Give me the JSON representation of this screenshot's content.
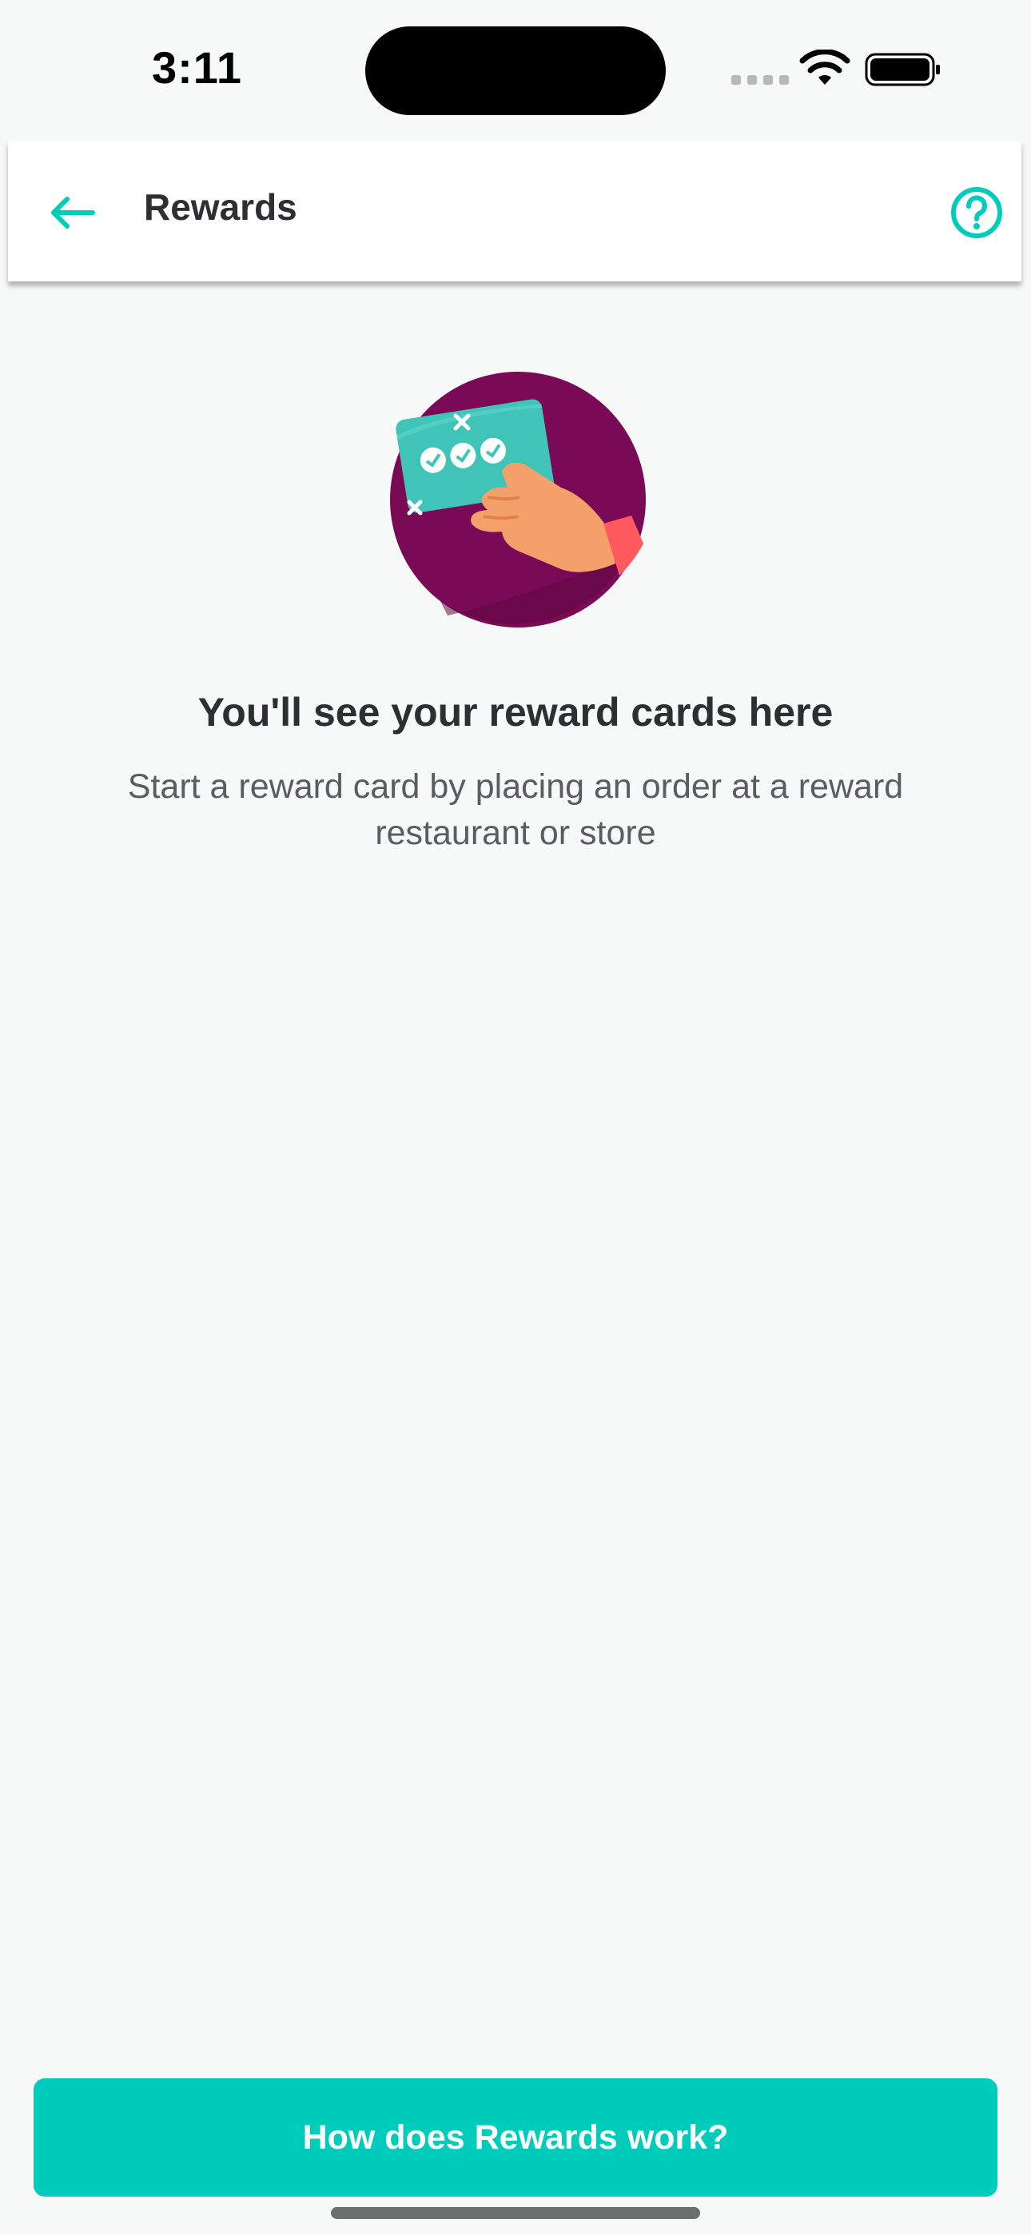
{
  "status_bar": {
    "time": "3:11"
  },
  "header": {
    "title": "Rewards",
    "back_icon": "arrow-left-icon",
    "help_icon": "question-circle-icon"
  },
  "empty_state": {
    "illustration": "hand-holding-reward-card-illustration",
    "title": "You'll see your reward cards here",
    "subtitle": "Start a reward card by placing an order at a reward restaurant or store"
  },
  "cta": {
    "label": "How does Rewards work?"
  },
  "colors": {
    "accent": "#00ccbc",
    "background": "#f7f8f8",
    "text_primary": "#2d2f30",
    "text_secondary": "#5a5d60",
    "illustration_circle": "#7a0a56",
    "illustration_card": "#3fc4b7",
    "illustration_hand": "#f4a06a"
  }
}
